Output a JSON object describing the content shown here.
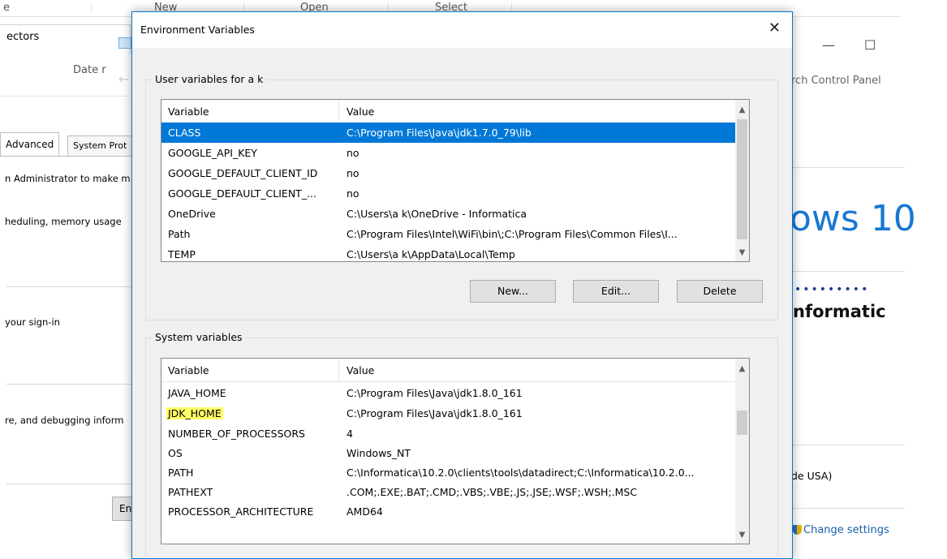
{
  "background": {
    "toolbar": {
      "new": "New",
      "open": "Open",
      "select": "Select",
      "left_fragment": "e"
    },
    "explorer": {
      "tab": "ectors",
      "date_col": "Date r"
    },
    "system_properties": {
      "tabs": [
        {
          "label": "Advanced"
        },
        {
          "label": "System Prot"
        }
      ],
      "lines": [
        "n Administrator to make m",
        "heduling, memory usage",
        "your sign-in",
        "re, and debugging inform"
      ],
      "button_fragment": "En"
    },
    "control_panel": {
      "minimize": "—",
      "maximize": "☐",
      "search": "rch Control Panel",
      "windows_logo": "ows 10",
      "company_dots": "•••••••••",
      "company": "nformatic",
      "locale": "de USA)",
      "change_settings": "Change settings"
    }
  },
  "dialog": {
    "title": "Environment Variables",
    "close": "✕",
    "user_group": {
      "label": "User variables for a        k",
      "columns": {
        "variable": "Variable",
        "value": "Value"
      },
      "rows": [
        {
          "variable": "CLASS",
          "value": "C:\\Program Files\\Java\\jdk1.7.0_79\\lib"
        },
        {
          "variable": "GOOGLE_API_KEY",
          "value": "no"
        },
        {
          "variable": "GOOGLE_DEFAULT_CLIENT_ID",
          "value": "no"
        },
        {
          "variable": "GOOGLE_DEFAULT_CLIENT_...",
          "value": "no"
        },
        {
          "variable": "OneDrive",
          "value": "C:\\Users\\a          k\\OneDrive - Informatica"
        },
        {
          "variable": "Path",
          "value": "C:\\Program Files\\Intel\\WiFi\\bin\\;C:\\Program Files\\Common Files\\I..."
        },
        {
          "variable": "TEMP",
          "value": "C:\\Users\\a          k\\AppData\\Local\\Temp"
        }
      ],
      "buttons": {
        "new": "New...",
        "edit": "Edit...",
        "delete": "Delete"
      }
    },
    "system_group": {
      "label": "System variables",
      "columns": {
        "variable": "Variable",
        "value": "Value"
      },
      "rows": [
        {
          "variable": "JAVA_HOME",
          "value": "C:\\Program Files\\Java\\jdk1.8.0_161"
        },
        {
          "variable": "JDK_HOME",
          "value": "C:\\Program Files\\Java\\jdk1.8.0_161"
        },
        {
          "variable": "NUMBER_OF_PROCESSORS",
          "value": "4"
        },
        {
          "variable": "OS",
          "value": "Windows_NT"
        },
        {
          "variable": "PATH",
          "value": "C:\\Informatica\\10.2.0\\clients\\tools\\datadirect;C:\\Informatica\\10.2.0..."
        },
        {
          "variable": "PATHEXT",
          "value": ".COM;.EXE;.BAT;.CMD;.VBS;.VBE;.JS;.JSE;.WSF;.WSH;.MSC"
        },
        {
          "variable": "PROCESSOR_ARCHITECTURE",
          "value": "AMD64"
        }
      ]
    }
  },
  "colors": {
    "selection": "#0078d7",
    "highlight": "#ffff66",
    "dialog_border": "#0078d7"
  }
}
